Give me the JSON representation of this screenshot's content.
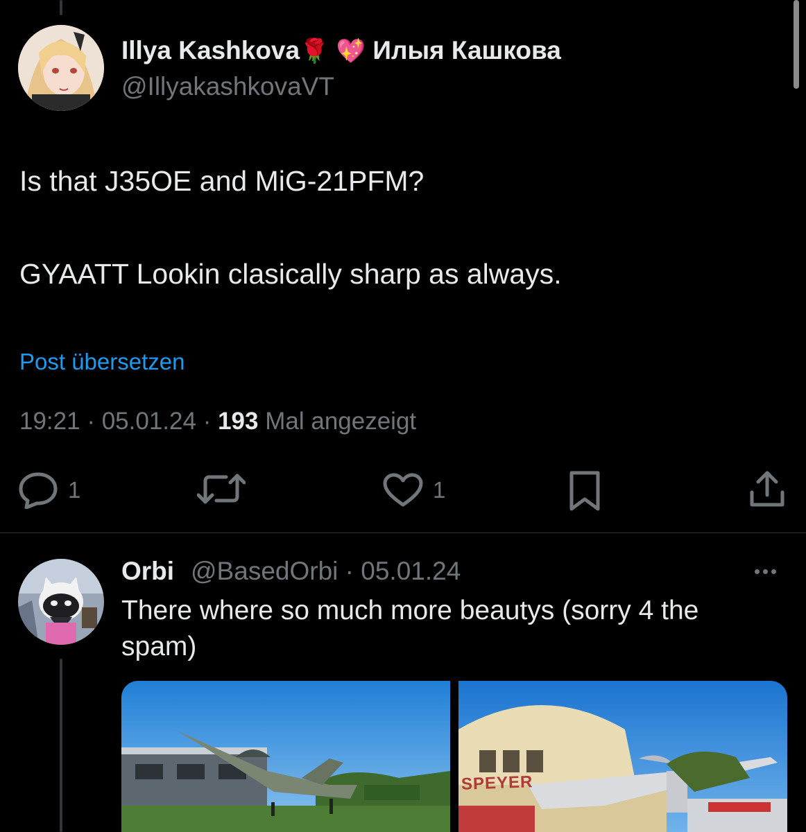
{
  "main_tweet": {
    "display_name": "Illya Kashkova",
    "emoji_rose": "🌹",
    "emoji_heart": "💖",
    "display_name_cyrillic": "Илыя Кашкова",
    "handle": "@IllyakashkovaVT",
    "text_line1": "Is that J35OE and MiG-21PFM?",
    "text_line2": "GYAATT Lookin clasically sharp as always.",
    "translate_label": "Post übersetzen",
    "time": "19:21",
    "date": "05.01.24",
    "separator": "·",
    "views_count": "193",
    "views_label": "Mal angezeigt",
    "reply_count": "1",
    "like_count": "1"
  },
  "reply": {
    "display_name": "Orbi",
    "handle": "@BasedOrbi",
    "separator": "·",
    "date": "05.01.24",
    "text": "There where so much more beautys (sorry 4 the spam)",
    "image_right_sign": "SPEYER"
  },
  "colors": {
    "background": "#000000",
    "text_primary": "#e7e9ea",
    "text_secondary": "#71767b",
    "accent_blue": "#1d9bf0",
    "divider": "#2f3336"
  }
}
